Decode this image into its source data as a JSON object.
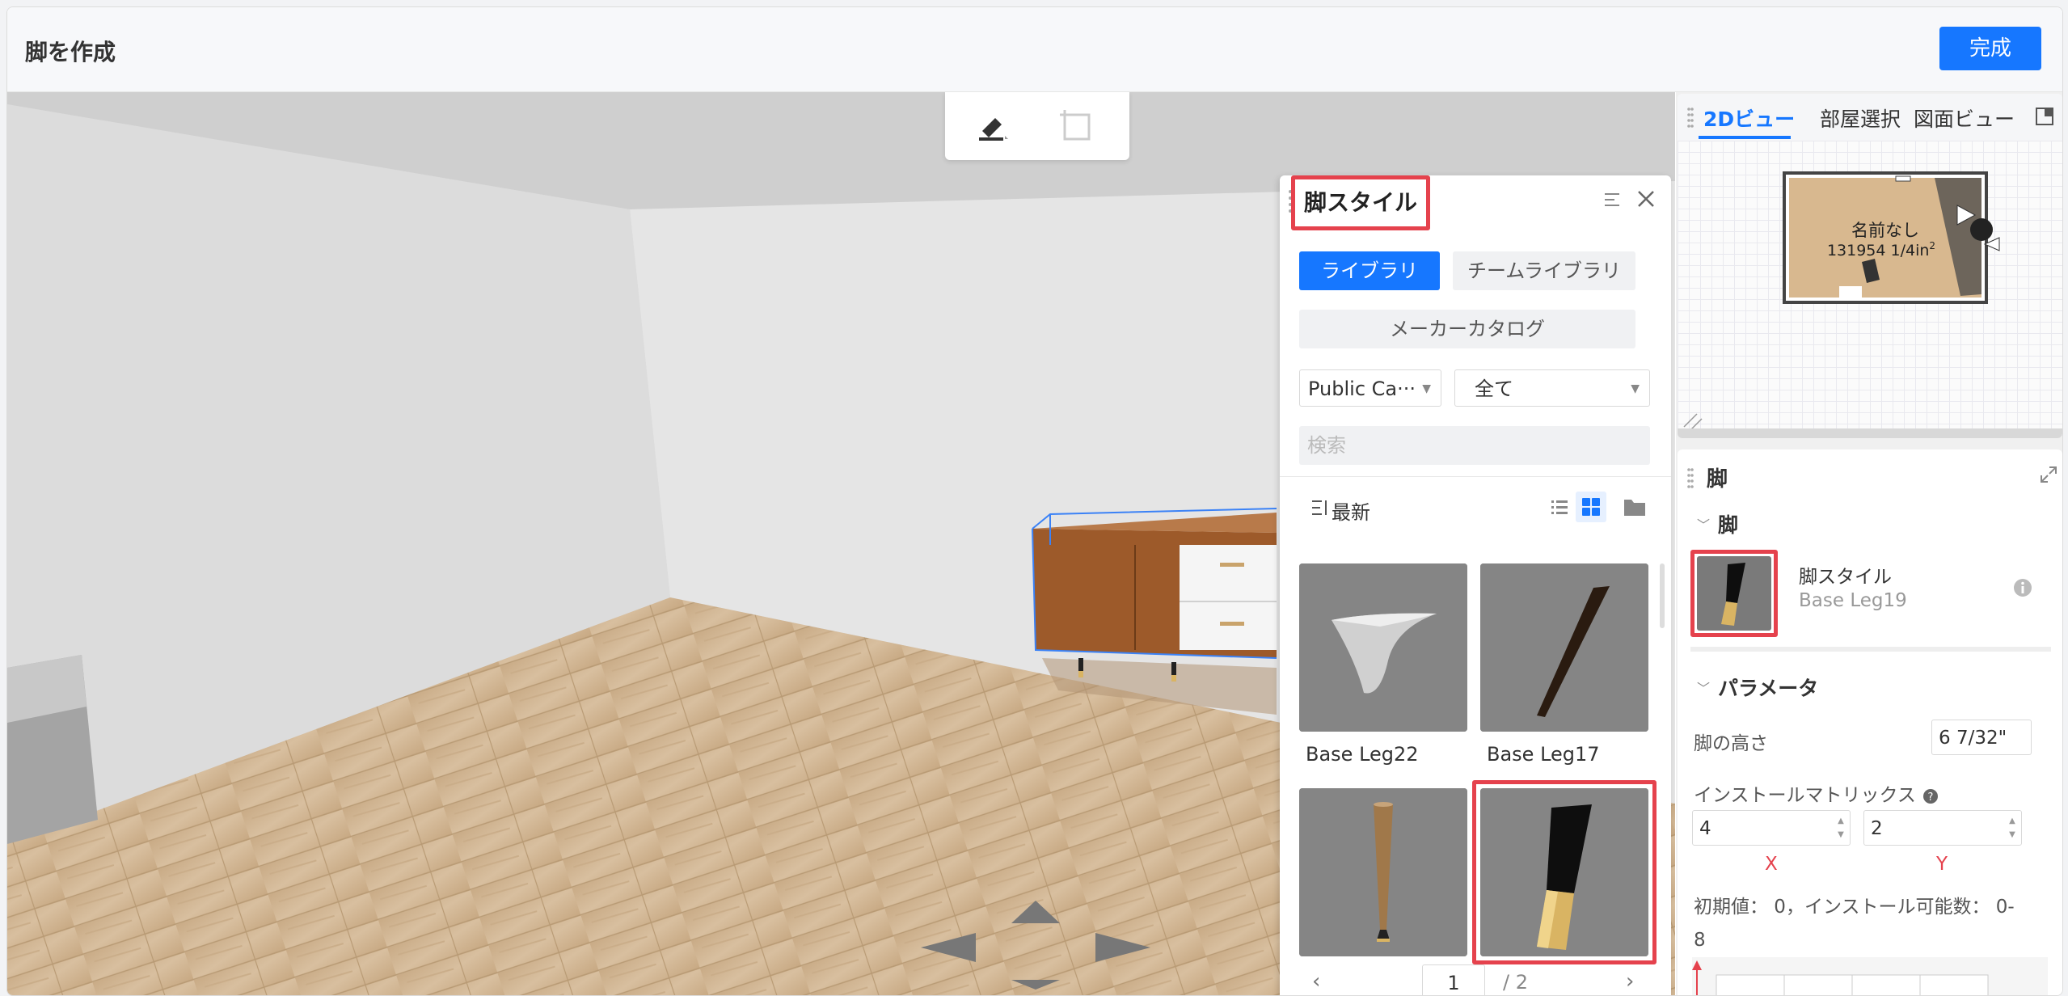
{
  "header": {
    "title": "脚を作成",
    "done_label": "完成"
  },
  "toolbar": {
    "brush_icon": "brush-icon",
    "add_icon": "add-frame-icon"
  },
  "leg_style_panel": {
    "title": "脚スタイル",
    "tabs": {
      "library": "ライブラリ",
      "team_library": "チームライブラリ"
    },
    "maker_catalog": "メーカーカタログ",
    "category_select": "Public Ca···",
    "filter_select": "全て",
    "search_placeholder": "検索",
    "sort_label": "最新",
    "items": [
      {
        "label": "Base Leg22"
      },
      {
        "label": "Base Leg17"
      },
      {
        "label": ""
      },
      {
        "label": ""
      }
    ],
    "pager": {
      "current": "1",
      "total": "/ 2"
    }
  },
  "view_panel": {
    "tabs": [
      "2Dビュー",
      "部屋選択",
      "図面ビュー"
    ],
    "active_tab": 0,
    "room_name": "名前なし",
    "room_area": "131954 1/4in",
    "room_area_sup": "2"
  },
  "property_panel": {
    "title": "脚",
    "section_leg": "脚",
    "style_label": "脚スタイル",
    "style_value": "Base Leg19",
    "section_params": "パラメータ",
    "leg_height_label": "脚の高さ",
    "leg_height_value": "6 7/32\"",
    "matrix_label": "インストールマトリックス",
    "matrix_x": "4",
    "matrix_y": "2",
    "x_label": "X",
    "y_label": "Y",
    "hint": "初期値： 0，インストール可能数： 0-",
    "hint_cont": "8"
  },
  "colors": {
    "accent": "#1677ff",
    "highlight": "#e5424d"
  }
}
